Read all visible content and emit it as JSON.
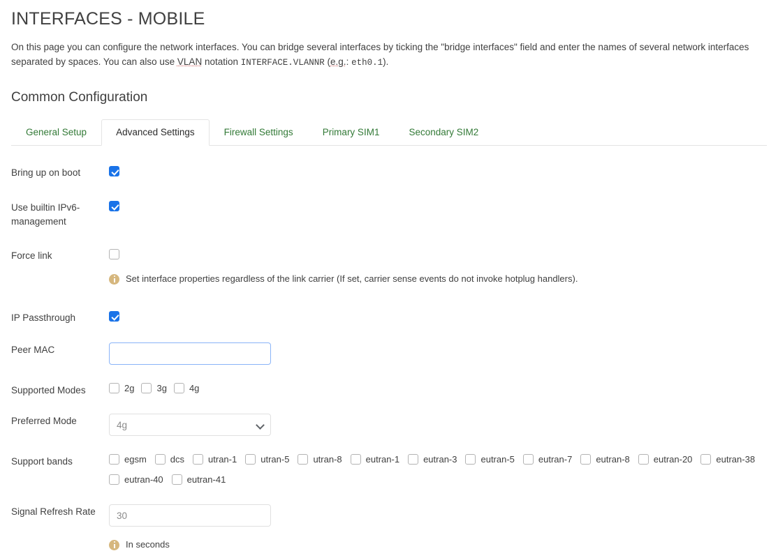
{
  "header": {
    "title": "INTERFACES - MOBILE",
    "intro_part1": "On this page you can configure the network interfaces. You can bridge several interfaces by ticking the \"bridge interfaces\" field and enter the names of several network interfaces separated by spaces. You can also use ",
    "intro_vlan": "VLAN",
    "intro_part2": " notation ",
    "intro_mono1": "INTERFACE.VLANNR",
    "intro_part3": " (",
    "intro_eg": "e.g.",
    "intro_part4": ": ",
    "intro_mono2": "eth0.1",
    "intro_part5": ")."
  },
  "section": {
    "title": "Common Configuration"
  },
  "tabs": {
    "items": [
      {
        "label": "General Setup",
        "active": false
      },
      {
        "label": "Advanced Settings",
        "active": true
      },
      {
        "label": "Firewall Settings",
        "active": false
      },
      {
        "label": "Primary SIM1",
        "active": false
      },
      {
        "label": "Secondary SIM2",
        "active": false
      }
    ]
  },
  "form": {
    "bring_up_on_boot": {
      "label": "Bring up on boot",
      "checked": true
    },
    "use_builtin_ipv6": {
      "label": "Use builtin IPv6-management",
      "checked": true
    },
    "force_link": {
      "label": "Force link",
      "checked": false,
      "help": "Set interface properties regardless of the link carrier (If set, carrier sense events do not invoke hotplug handlers)."
    },
    "ip_passthrough": {
      "label": "IP Passthrough",
      "checked": true
    },
    "peer_mac": {
      "label": "Peer MAC",
      "value": "",
      "placeholder": ""
    },
    "supported_modes": {
      "label": "Supported Modes",
      "options": [
        {
          "label": "2g",
          "checked": false
        },
        {
          "label": "3g",
          "checked": false
        },
        {
          "label": "4g",
          "checked": false
        }
      ]
    },
    "preferred_mode": {
      "label": "Preferred Mode",
      "selected": "4g",
      "options": [
        "2g",
        "3g",
        "4g"
      ]
    },
    "support_bands": {
      "label": "Support bands",
      "options": [
        {
          "label": "egsm",
          "checked": false
        },
        {
          "label": "dcs",
          "checked": false
        },
        {
          "label": "utran-1",
          "checked": false
        },
        {
          "label": "utran-5",
          "checked": false
        },
        {
          "label": "utran-8",
          "checked": false
        },
        {
          "label": "eutran-1",
          "checked": false
        },
        {
          "label": "eutran-3",
          "checked": false
        },
        {
          "label": "eutran-5",
          "checked": false
        },
        {
          "label": "eutran-7",
          "checked": false
        },
        {
          "label": "eutran-8",
          "checked": false
        },
        {
          "label": "eutran-20",
          "checked": false
        },
        {
          "label": "eutran-38",
          "checked": false
        },
        {
          "label": "eutran-40",
          "checked": false
        },
        {
          "label": "eutran-41",
          "checked": false
        }
      ]
    },
    "signal_refresh_rate": {
      "label": "Signal Refresh Rate",
      "value": "",
      "placeholder": "30",
      "help": "In seconds"
    }
  },
  "colors": {
    "tab_link": "#337a37",
    "checkbox_checked": "#1a73e8",
    "help_icon": "#d6b77e",
    "input_focus_border": "#8ab4f8"
  }
}
